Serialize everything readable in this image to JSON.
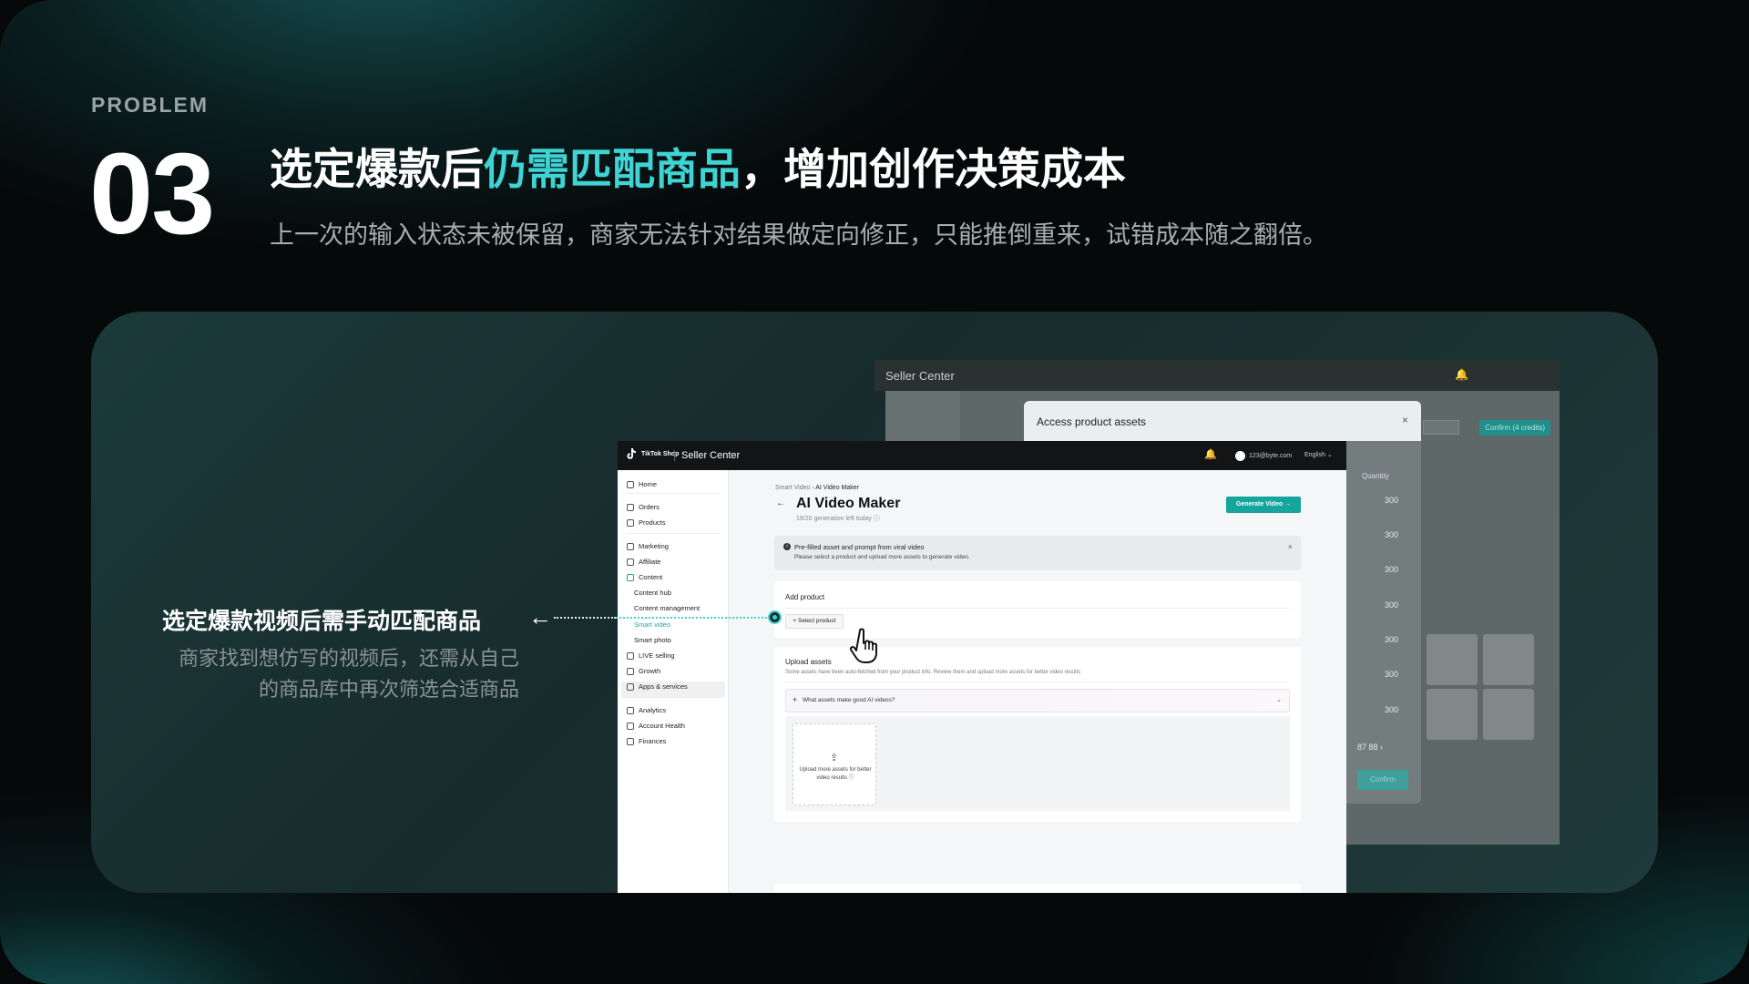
{
  "header": {
    "eyebrow": "PROBLEM",
    "number": "03",
    "headline_before": "选定爆款后",
    "headline_highlight": "仍需匹配商品",
    "headline_after": "，增加创作决策成本",
    "subline": "上一次的输入状态未被保留，商家无法针对结果做定向修正，只能推倒重来，试错成本随之翻倍。",
    "highlight_color": "#3fd3d3"
  },
  "annotation": {
    "title": "选定爆款视频后需手动匹配商品",
    "arrow": "←",
    "body": "商家找到想仿写的视频后，还需从自己的商品库中再次筛选合适商品"
  },
  "back_window": {
    "title": "Seller Center",
    "confirm_top": "Confirm (4 credits)",
    "modal_title": "Access product assets",
    "close": "×",
    "quantity_header": "Quantity",
    "quantities": [
      "300",
      "300",
      "300",
      "300",
      "300",
      "300",
      "300"
    ],
    "pagination": "87   88   ›",
    "confirm": "Confirm"
  },
  "window": {
    "brand": "TikTok Shop",
    "title": "Seller Center",
    "account": "123@byte.com",
    "language": "English",
    "sidebar": {
      "home": "Home",
      "orders": "Orders",
      "products": "Products",
      "marketing": "Marketing",
      "affiliate": "Affiliate",
      "content": "Content",
      "content_hub": "Content hub",
      "content_management": "Content management",
      "smart_video": "Smart video",
      "smart_photo": "Smart photo",
      "live_selling": "LIVE selling",
      "growth": "Growth",
      "apps_services": "Apps & services",
      "analytics": "Analytics",
      "account_health": "Account Health",
      "finances": "Finances"
    },
    "breadcrumb": {
      "parent": "Smart Video",
      "sep": "›",
      "current": "AI Video Maker"
    },
    "page_title": "AI Video Maker",
    "page_sub": "19/20 generation left today ⓘ",
    "generate_button": "Generate Video →",
    "banner": {
      "title": "Pre-filled asset and prompt from viral video",
      "text": "Please select a product and upload more assets to generate video."
    },
    "add_product": {
      "title": "Add product",
      "button": "+ Select product"
    },
    "upload": {
      "title": "Upload assets",
      "subtitle": "Some assets have been auto-fetched from your product info. Review them and upload more assets for better video results",
      "faq": "What assets make good AI videos?",
      "box_text": "Upload more assets for better video results ⓘ"
    }
  }
}
